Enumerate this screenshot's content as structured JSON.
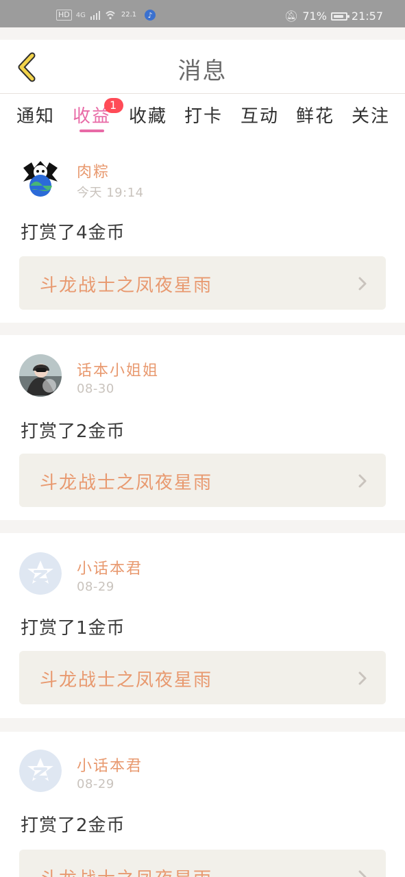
{
  "status_bar": {
    "hd": "HD",
    "network": "4G",
    "speed": "22.1",
    "battery_percent": "71%",
    "time": "21:57"
  },
  "header": {
    "title": "消息"
  },
  "tabs": {
    "items": [
      {
        "label": "通知"
      },
      {
        "label": "收益",
        "badge": "1"
      },
      {
        "label": "收藏"
      },
      {
        "label": "打卡"
      },
      {
        "label": "互动"
      },
      {
        "label": "鲜花"
      },
      {
        "label": "关注"
      }
    ],
    "active_index": 1
  },
  "feed": {
    "items": [
      {
        "username": "肉粽",
        "time": "今天 19:14",
        "message": "打赏了4金币",
        "book_title": "斗龙战士之凤夜星雨",
        "avatar_icon": "earth-skull-avatar"
      },
      {
        "username": "话本小姐姐",
        "time": "08-30",
        "message": "打赏了2金币",
        "book_title": "斗龙战士之凤夜星雨",
        "avatar_icon": "photo-avatar"
      },
      {
        "username": "小话本君",
        "time": "08-29",
        "message": "打赏了1金币",
        "book_title": "斗龙战士之凤夜星雨",
        "avatar_icon": "default-star-avatar"
      },
      {
        "username": "小话本君",
        "time": "08-29",
        "message": "打赏了2金币",
        "book_title": "斗龙战士之凤夜星雨",
        "avatar_icon": "default-star-avatar"
      }
    ]
  },
  "colors": {
    "accent_pink": "#e86aa6",
    "accent_orange": "#e8996f",
    "badge_red": "#ff4b57",
    "muted_text": "#c9c3bd"
  }
}
